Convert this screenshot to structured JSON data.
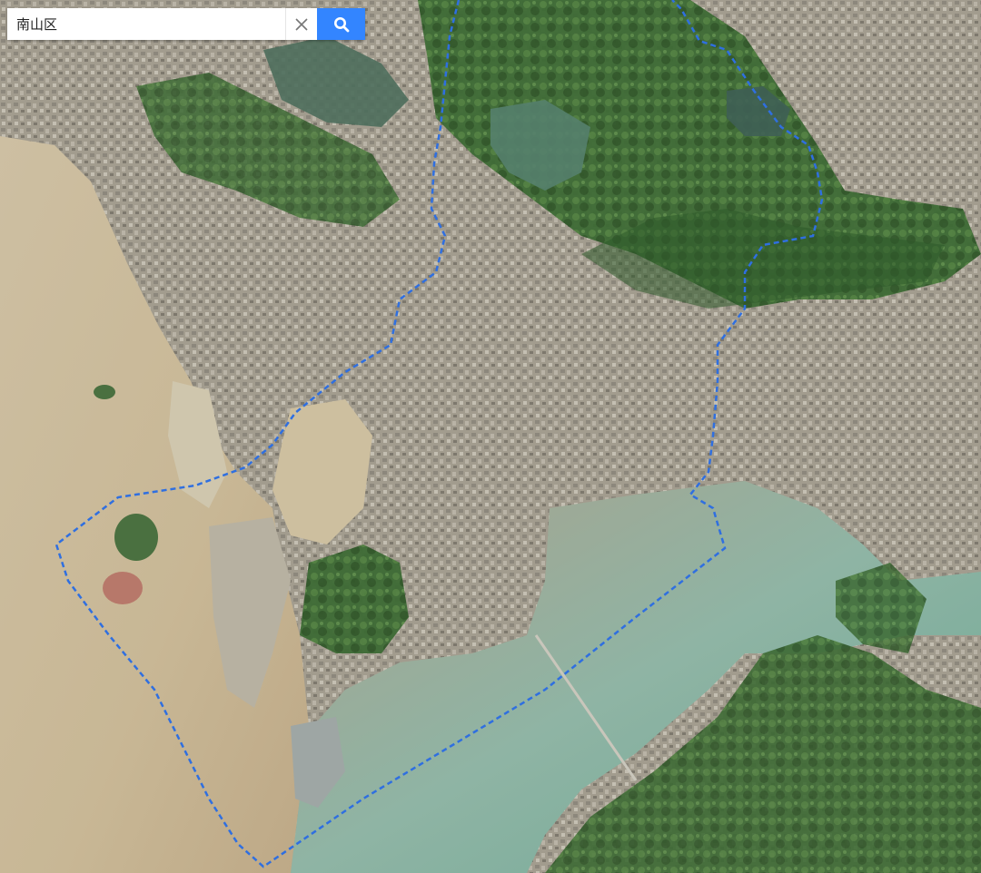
{
  "search": {
    "value": "南山区",
    "clear_icon": "close-icon",
    "submit_icon": "search-icon"
  },
  "map": {
    "type": "satellite",
    "boundary_style": "blue dashed line",
    "colors": {
      "boundary": "#2f6fe0",
      "water_west": "#c9b797",
      "water_bay": "#8fb3a0",
      "land_urban": "#a8a294",
      "vegetation": "#3f6b35",
      "search_button": "#3385ff"
    }
  }
}
